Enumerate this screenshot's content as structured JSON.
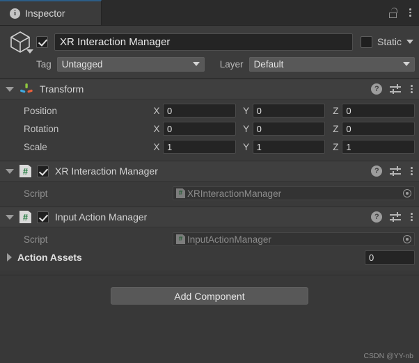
{
  "window": {
    "tab_label": "Inspector",
    "tab_icon": "info-icon",
    "lock_icon": "lock-open-icon",
    "menu_icon": "kebab-menu-icon"
  },
  "gameobject": {
    "icon": "cube-icon",
    "enabled": true,
    "name": "XR Interaction Manager",
    "static_label": "Static",
    "static_checked": false,
    "tag_label": "Tag",
    "tag_value": "Untagged",
    "layer_label": "Layer",
    "layer_value": "Default"
  },
  "components": [
    {
      "title": "Transform",
      "icon": "transform-gizmo-icon",
      "expanded": true,
      "has_checkbox": false,
      "rows": [
        {
          "label": "Position",
          "axes": [
            "X",
            "Y",
            "Z"
          ],
          "values": [
            "0",
            "0",
            "0"
          ]
        },
        {
          "label": "Rotation",
          "axes": [
            "X",
            "Y",
            "Z"
          ],
          "values": [
            "0",
            "0",
            "0"
          ]
        },
        {
          "label": "Scale",
          "axes": [
            "X",
            "Y",
            "Z"
          ],
          "values": [
            "1",
            "1",
            "1"
          ]
        }
      ]
    },
    {
      "title": "XR Interaction Manager",
      "icon": "csharp-script-icon",
      "expanded": true,
      "has_checkbox": true,
      "checked": true,
      "script_label": "Script",
      "script_value": "XRInteractionManager"
    },
    {
      "title": "Input Action Manager",
      "icon": "csharp-script-icon",
      "expanded": true,
      "has_checkbox": true,
      "checked": true,
      "script_label": "Script",
      "script_value": "InputActionManager",
      "array_label": "Action Assets",
      "array_size": "0",
      "array_expanded": false
    }
  ],
  "header_icons": {
    "help": "?",
    "help_name": "help-icon",
    "preset": "preset-icon",
    "menu": "kebab-menu-icon"
  },
  "footer": {
    "add_component_label": "Add Component",
    "watermark": "CSDN @YY-nb"
  },
  "colors": {
    "panel_bg": "#383838",
    "header_bg": "#3f3f3f",
    "field_bg": "#242424",
    "accent_tab": "#2c5d87",
    "script_green": "#1f7a3d"
  }
}
